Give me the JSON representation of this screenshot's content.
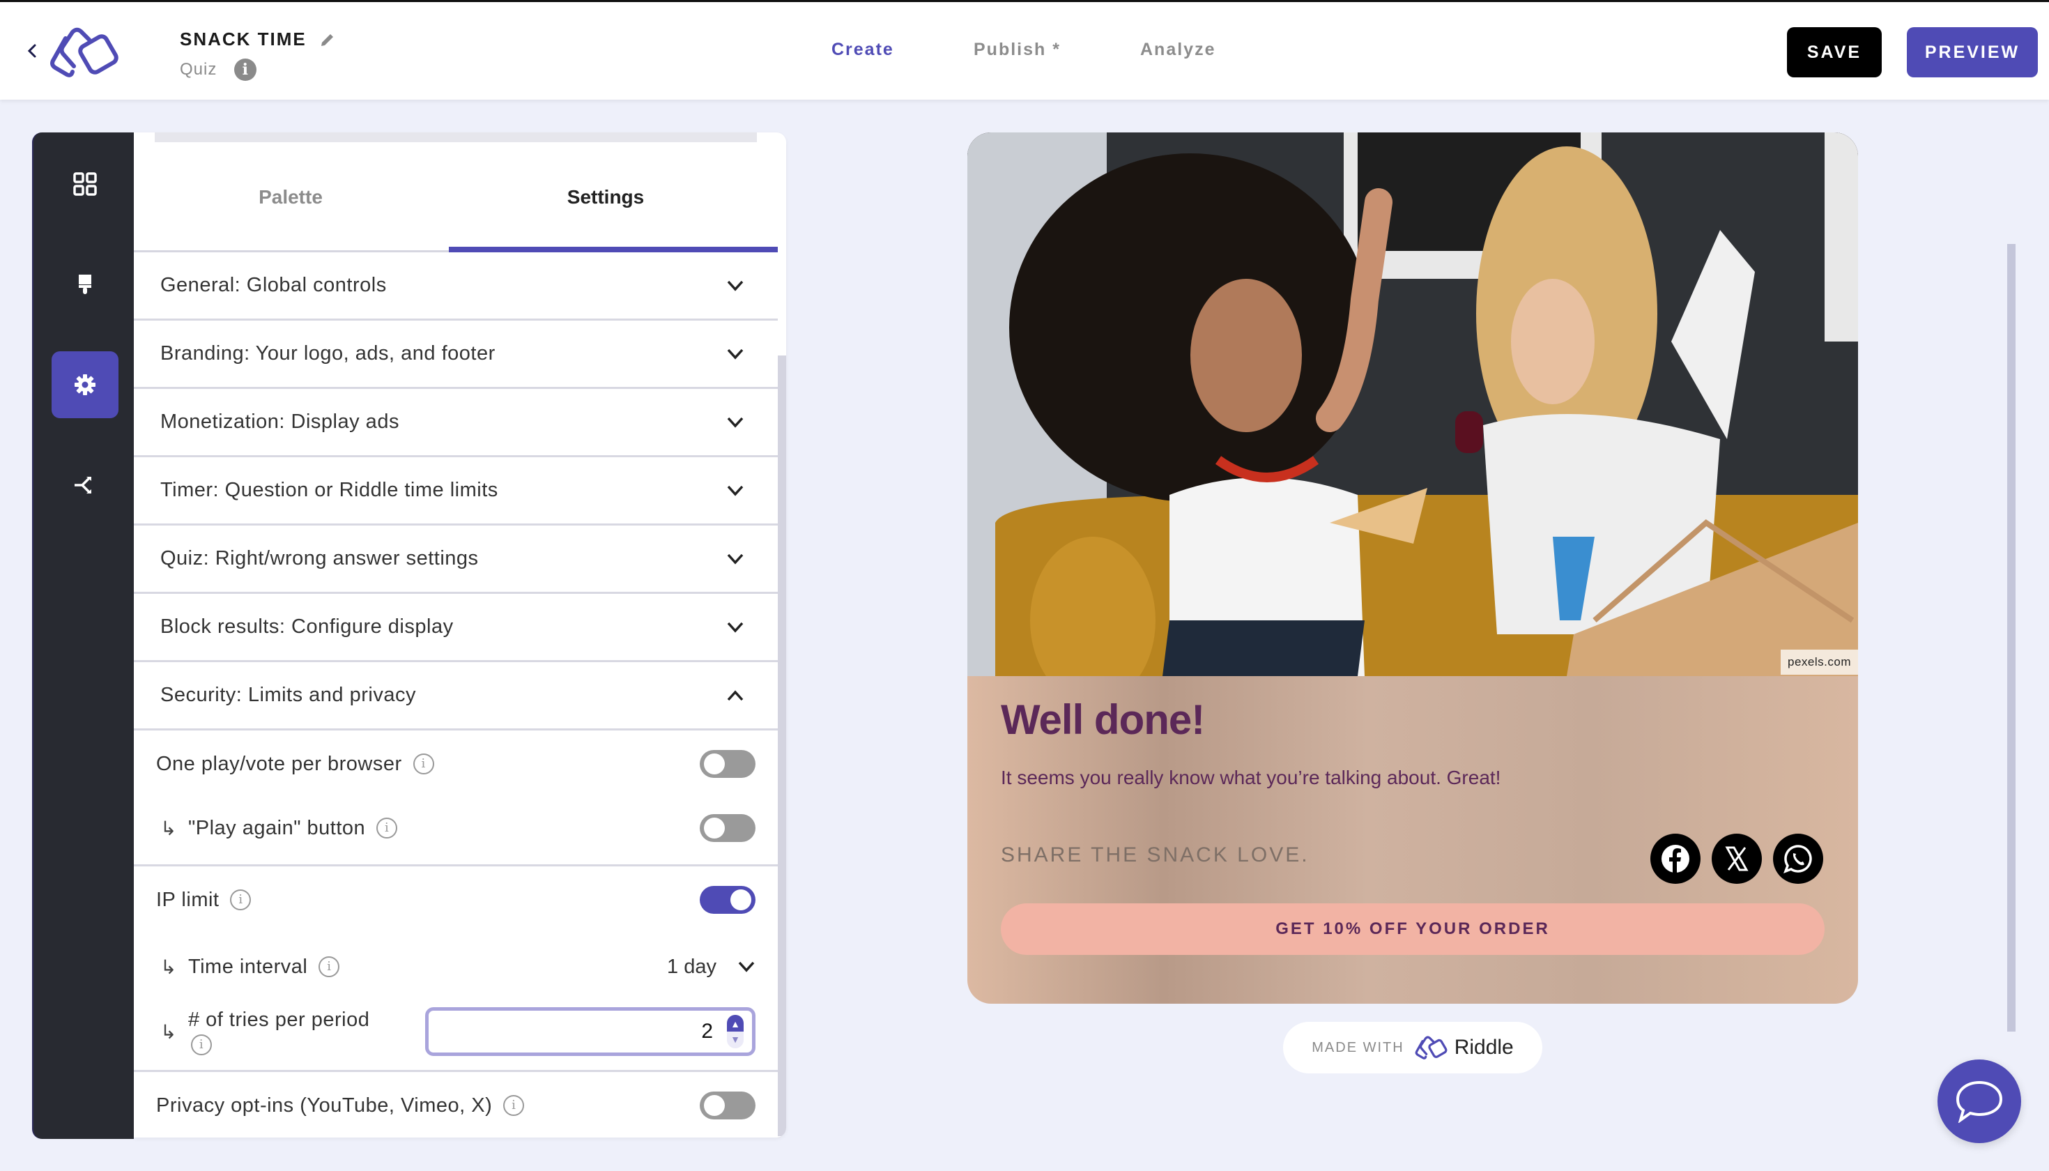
{
  "header": {
    "title": "SNACK TIME",
    "subtitle": "Quiz",
    "info_glyph": "i",
    "nav": [
      {
        "label": "Create",
        "active": true
      },
      {
        "label": "Publish *",
        "active": false
      },
      {
        "label": "Analyze",
        "active": false
      }
    ],
    "save_label": "SAVE",
    "preview_label": "PREVIEW"
  },
  "colors": {
    "accent": "#4f4bb5",
    "sidebar_bg": "#282a31",
    "result_text": "#5b2858",
    "cta_bg": "#f2b3a4",
    "page_bg": "#eef0fa"
  },
  "sidebar": {
    "items": [
      {
        "icon": "grid-icon",
        "active": false
      },
      {
        "icon": "paintbrush-icon",
        "active": false
      },
      {
        "icon": "gear-icon",
        "active": true
      },
      {
        "icon": "share-branch-icon",
        "active": false
      }
    ]
  },
  "panel": {
    "tabs": [
      {
        "label": "Palette",
        "active": false
      },
      {
        "label": "Settings",
        "active": true
      }
    ],
    "accordion": [
      {
        "label": "General: Global controls",
        "expanded": false
      },
      {
        "label": "Branding: Your logo, ads, and footer",
        "expanded": false
      },
      {
        "label": "Monetization: Display ads",
        "expanded": false
      },
      {
        "label": "Timer: Question or Riddle time limits",
        "expanded": false
      },
      {
        "label": "Quiz: Right/wrong answer settings",
        "expanded": false
      },
      {
        "label": "Block results: Configure display",
        "expanded": false
      },
      {
        "label": "Security: Limits and privacy",
        "expanded": true
      }
    ],
    "security": {
      "one_play": {
        "label": "One play/vote per browser",
        "on": false
      },
      "play_again": {
        "label": "\"Play again\" button",
        "on": false
      },
      "ip_limit": {
        "label": "IP limit",
        "on": true
      },
      "time_interval": {
        "label": "Time interval",
        "value": "1 day"
      },
      "tries": {
        "label": "# of tries per period",
        "value": "2"
      },
      "privacy": {
        "label": "Privacy opt-ins (YouTube, Vimeo, X)",
        "on": false
      },
      "sub_arrow": "↳"
    }
  },
  "preview": {
    "photo_credit": "pexels.com",
    "result_title": "Well done!",
    "result_text": "It seems you really know what you’re talking about. Great!",
    "share_text": "SHARE THE SNACK LOVE.",
    "social": [
      "facebook-icon",
      "x-icon",
      "whatsapp-icon"
    ],
    "cta_label": "GET 10% OFF YOUR ORDER",
    "made_with": "MADE WITH",
    "brand": "Riddle"
  }
}
